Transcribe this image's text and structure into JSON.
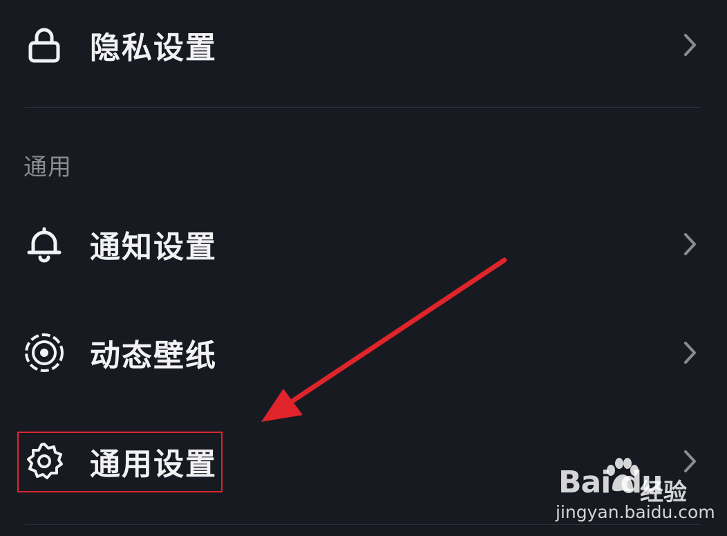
{
  "rows": [
    {
      "label": "隐私设置",
      "icon": "lock-icon"
    },
    {
      "label": "通知设置",
      "icon": "bell-icon"
    },
    {
      "label": "动态壁纸",
      "icon": "live-wallpaper-icon"
    },
    {
      "label": "通用设置",
      "icon": "gear-icon"
    }
  ],
  "section": {
    "header": "通用"
  },
  "annotation": {
    "box_color": "#e0242b",
    "arrow_color": "#e0242b"
  },
  "watermark": {
    "logo": "Bai du",
    "brand_cn": "经验",
    "url": "jingyan.baidu.com"
  },
  "colors": {
    "background": "#171a21",
    "text": "#f2f2f4",
    "muted": "#8a8c93",
    "chevron": "#8a8c93"
  }
}
